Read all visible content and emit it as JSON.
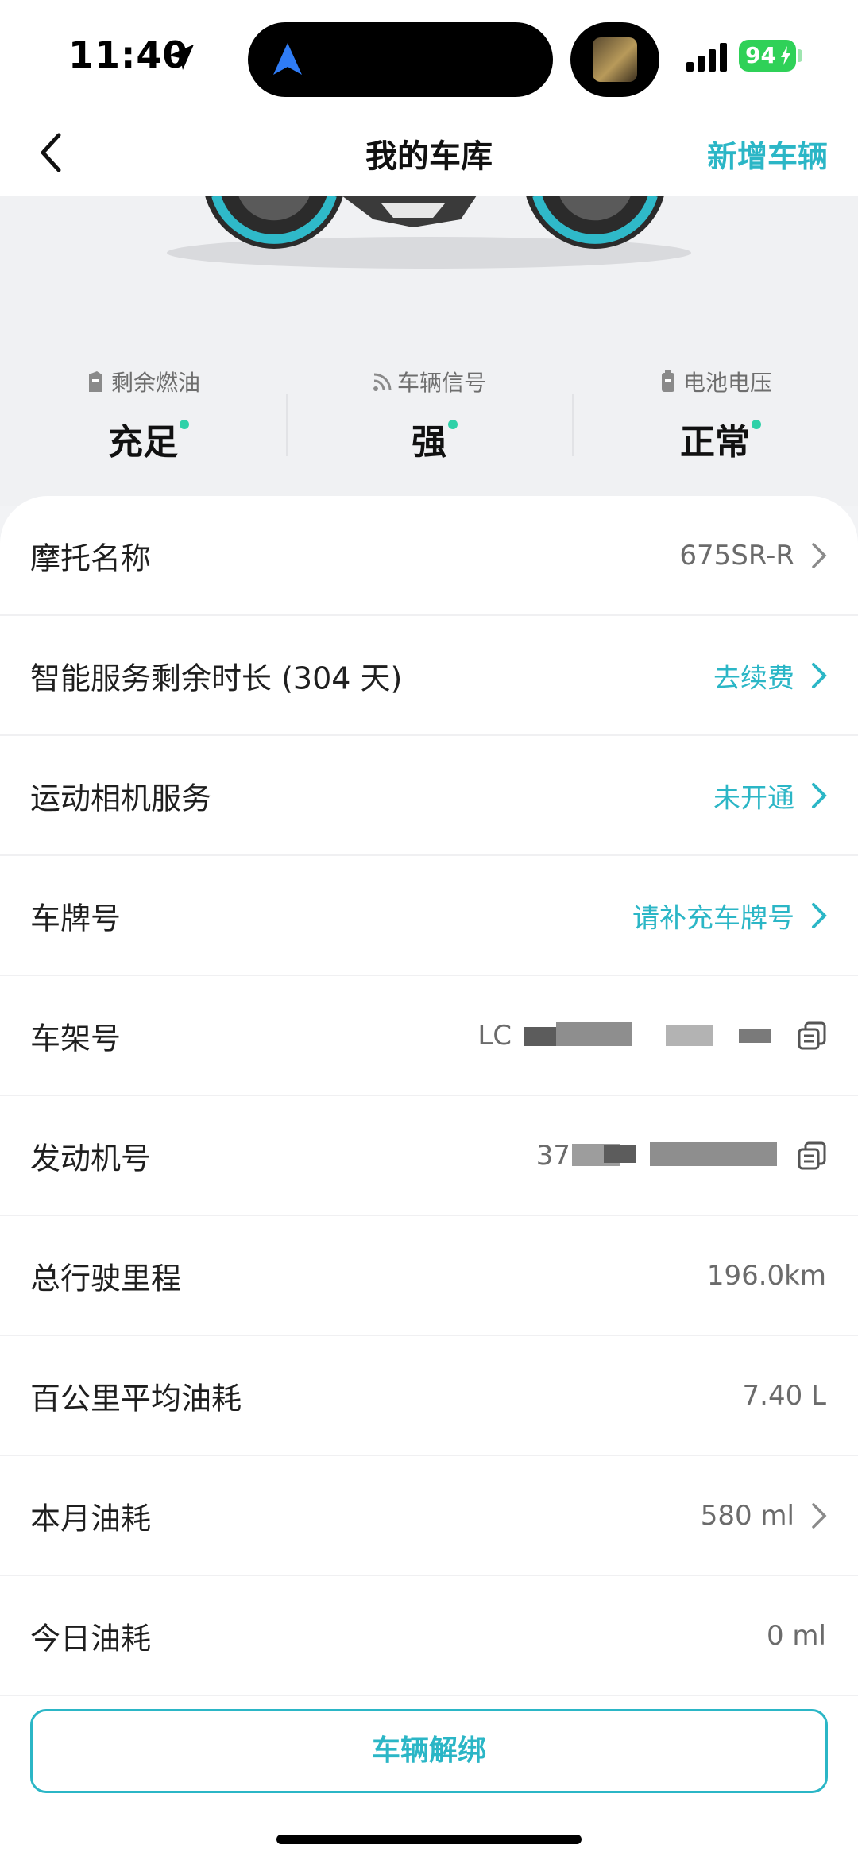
{
  "status_bar": {
    "time": "11:40",
    "battery": "94",
    "colors": {
      "battery": "#2fd158",
      "nav_pill_icon": "#2f7cf6"
    },
    "icons": [
      "location-arrow-icon",
      "navigation-icon",
      "signal-icon",
      "battery-charging-icon"
    ]
  },
  "nav": {
    "title": "我的车库",
    "add_label": "新增车辆"
  },
  "stats": [
    {
      "label": "剩余燃油",
      "value": "充足",
      "icon": "fuel-icon"
    },
    {
      "label": "车辆信号",
      "value": "强",
      "icon": "signal-wave-icon"
    },
    {
      "label": "电池电压",
      "value": "正常",
      "icon": "battery-icon"
    }
  ],
  "rows": {
    "moto_name": {
      "label": "摩托名称",
      "value": "675SR-R"
    },
    "smart_service": {
      "label": "智能服务剩余时长 (304 天)",
      "value": "去续费"
    },
    "camera_service": {
      "label": "运动相机服务",
      "value": "未开通"
    },
    "plate": {
      "label": "车牌号",
      "value": "请补充车牌号"
    },
    "frame_no": {
      "label": "车架号",
      "value": "LC"
    },
    "engine_no": {
      "label": "发动机号",
      "value": "37"
    },
    "mileage": {
      "label": "总行驶里程",
      "value": "196.0km"
    },
    "avg_fuel": {
      "label": "百公里平均油耗",
      "value": "7.40 L"
    },
    "month_fuel": {
      "label": "本月油耗",
      "value": "580 ml"
    },
    "today_fuel": {
      "label": "今日油耗",
      "value": "0 ml"
    }
  },
  "unbind_label": "车辆解绑",
  "colors": {
    "accent": "#2bb6c6",
    "status_dot": "#2fd1a8"
  }
}
